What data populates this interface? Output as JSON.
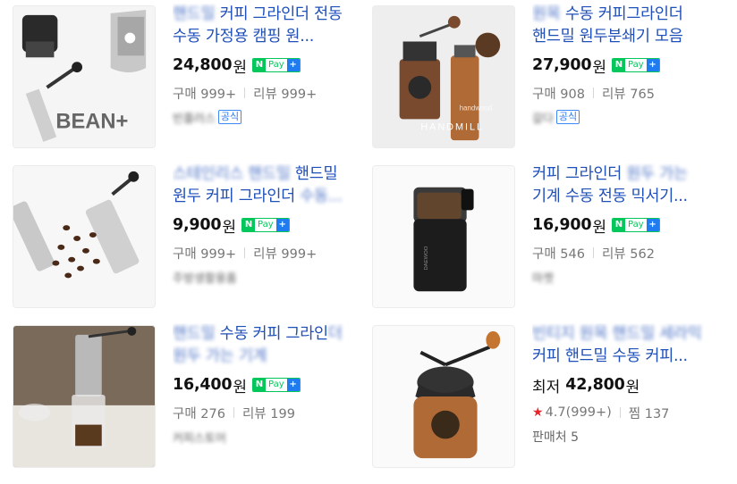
{
  "currency_unit": "원",
  "npay": {
    "n": "N",
    "pay": "Pay",
    "plus": "+"
  },
  "official_badge": "공식",
  "products": [
    {
      "title_blurred": "핸드밀",
      "title": " 커피 그라인더 전동 수동 가정용 캠핑 원...",
      "price": "24,800",
      "meta1": "구매 999+",
      "meta2": "리뷰 999+",
      "seller": "빈플러스"
    },
    {
      "title_blurred": "원목",
      "title": " 수동 커피그라인더 핸드밀 원두분쇄기 모음",
      "price": "27,900",
      "meta1": "구매 908",
      "meta2": "리뷰 765",
      "seller": "갈다"
    },
    {
      "title_blurred": "스테인리스 핸드밀",
      "title": " 핸드밀 원두 커피 그라인더",
      "title_tail_blurred": " 수동...",
      "price": "9,900",
      "meta1": "구매 999+",
      "meta2": "리뷰 999+",
      "seller": "주방생활용품"
    },
    {
      "title": "커피 그라인더",
      "title_blurred": " 원두 가는",
      "title2": " 기계 수동 전동 믹서기...",
      "price": "16,900",
      "meta1": "구매 546",
      "meta2": "리뷰 562",
      "seller": "마켓"
    },
    {
      "title_blurred": "핸드밀",
      "title": " 수동 커피 그라인",
      "title_tail_blurred": "더 원두 가는 기계",
      "price": "16,400",
      "meta1": "구매 276",
      "meta2": "리뷰 199",
      "seller": "커피스토어"
    },
    {
      "title_blurred": "빈티지 원목 핸드밀 세라믹",
      "title": " 커피 핸드밀 수동 커피...",
      "price_prefix": "최저",
      "price": "42,800",
      "rating": "4.7(999+)",
      "zzim": "찜 137",
      "seller_count": "판매처 5"
    }
  ],
  "image_texts": {
    "brand_bean": "BEAN+",
    "handwood_1": "handwood",
    "handwood_2": "HANDMILL"
  },
  "colors": {
    "title": "#1f4fb8",
    "price": "#111111",
    "npay_green": "#03c75a",
    "npay_blue": "#1e7cf0",
    "meta": "#777777",
    "star": "#e8242b"
  },
  "icons": [
    "npay-icon",
    "star-icon"
  ]
}
